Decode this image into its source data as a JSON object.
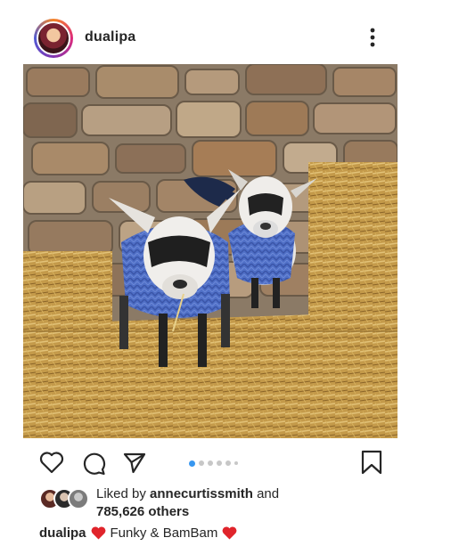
{
  "post": {
    "username": "dualipa",
    "avatar_icon": "profile-avatar",
    "more_icon": "more-vertical-icon",
    "carousel": {
      "count": 6,
      "active_index": 0
    },
    "likes": {
      "prefix": "Liked by ",
      "liker": "annecurtissmith",
      "conjunction": " and",
      "others": "785,626 others"
    },
    "caption": {
      "username": "dualipa",
      "text": "Funky & BamBam",
      "emoji": "red-heart"
    }
  },
  "colors": {
    "text": "#262626",
    "carousel_active": "#3897f0",
    "carousel_inactive": "#c7c7c7",
    "heart": "#e0242b"
  },
  "actions": {
    "like_icon": "heart-outline-icon",
    "comment_icon": "comment-icon",
    "share_icon": "paper-plane-icon",
    "save_icon": "bookmark-icon"
  }
}
